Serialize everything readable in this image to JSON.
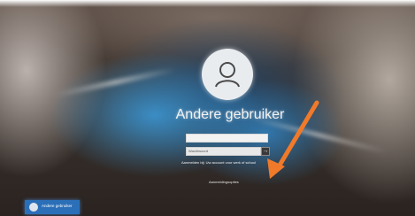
{
  "login": {
    "username": "Andere gebruiker",
    "username_value": "",
    "password_placeholder": "Wachtwoord",
    "submit_symbol": "→",
    "signin_help": "Aanmelden bij: Uw account voor werk of school",
    "signin_options": "Aanmeldingsopties"
  },
  "user_switcher": {
    "label": "Andere gebruiker"
  },
  "annotation": {
    "arrow_color": "#f07a2a"
  }
}
